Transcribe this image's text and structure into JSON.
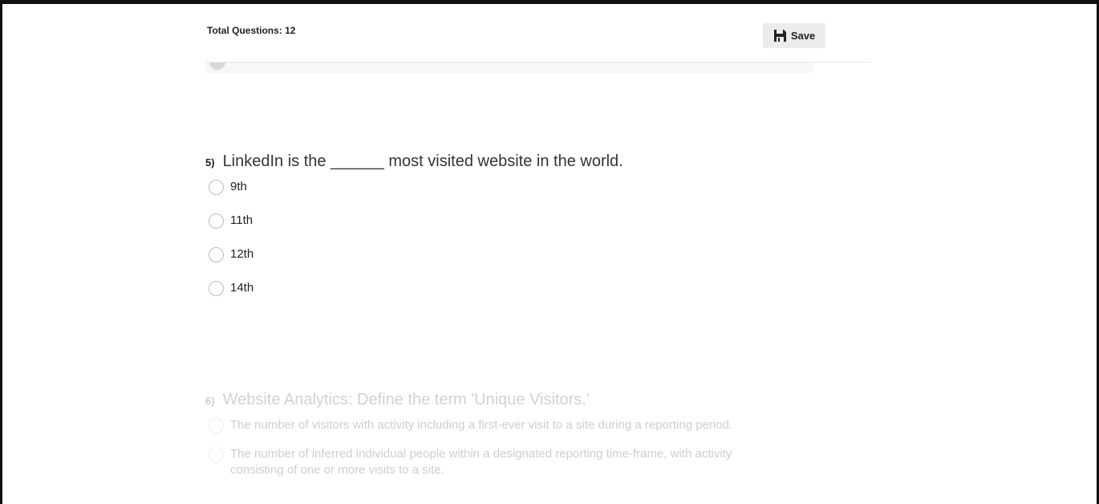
{
  "header": {
    "total_questions": "Total Questions: 12",
    "save_label": "Save",
    "save_icon": "floppy-disk-icon"
  },
  "previous_question": {
    "partial_option_label": "False"
  },
  "questions": [
    {
      "number": "5)",
      "text": "LinkedIn is the ______ most visited website in the world.",
      "options": [
        "9th",
        "11th",
        "12th",
        "14th"
      ],
      "selected": null
    },
    {
      "number": "6)",
      "text": "Website Analytics: Define the term 'Unique Visitors.'",
      "options": [
        "The number of visitors with activity including a first-ever visit to a site during a reporting period.",
        "The number of inferred individual people within a designated reporting time-frame, with activity consisting of one or more visits to a site."
      ],
      "selected": null
    }
  ],
  "colors": {
    "frame_border": "#111111",
    "save_button_bg": "#ececec",
    "text": "#222222"
  }
}
